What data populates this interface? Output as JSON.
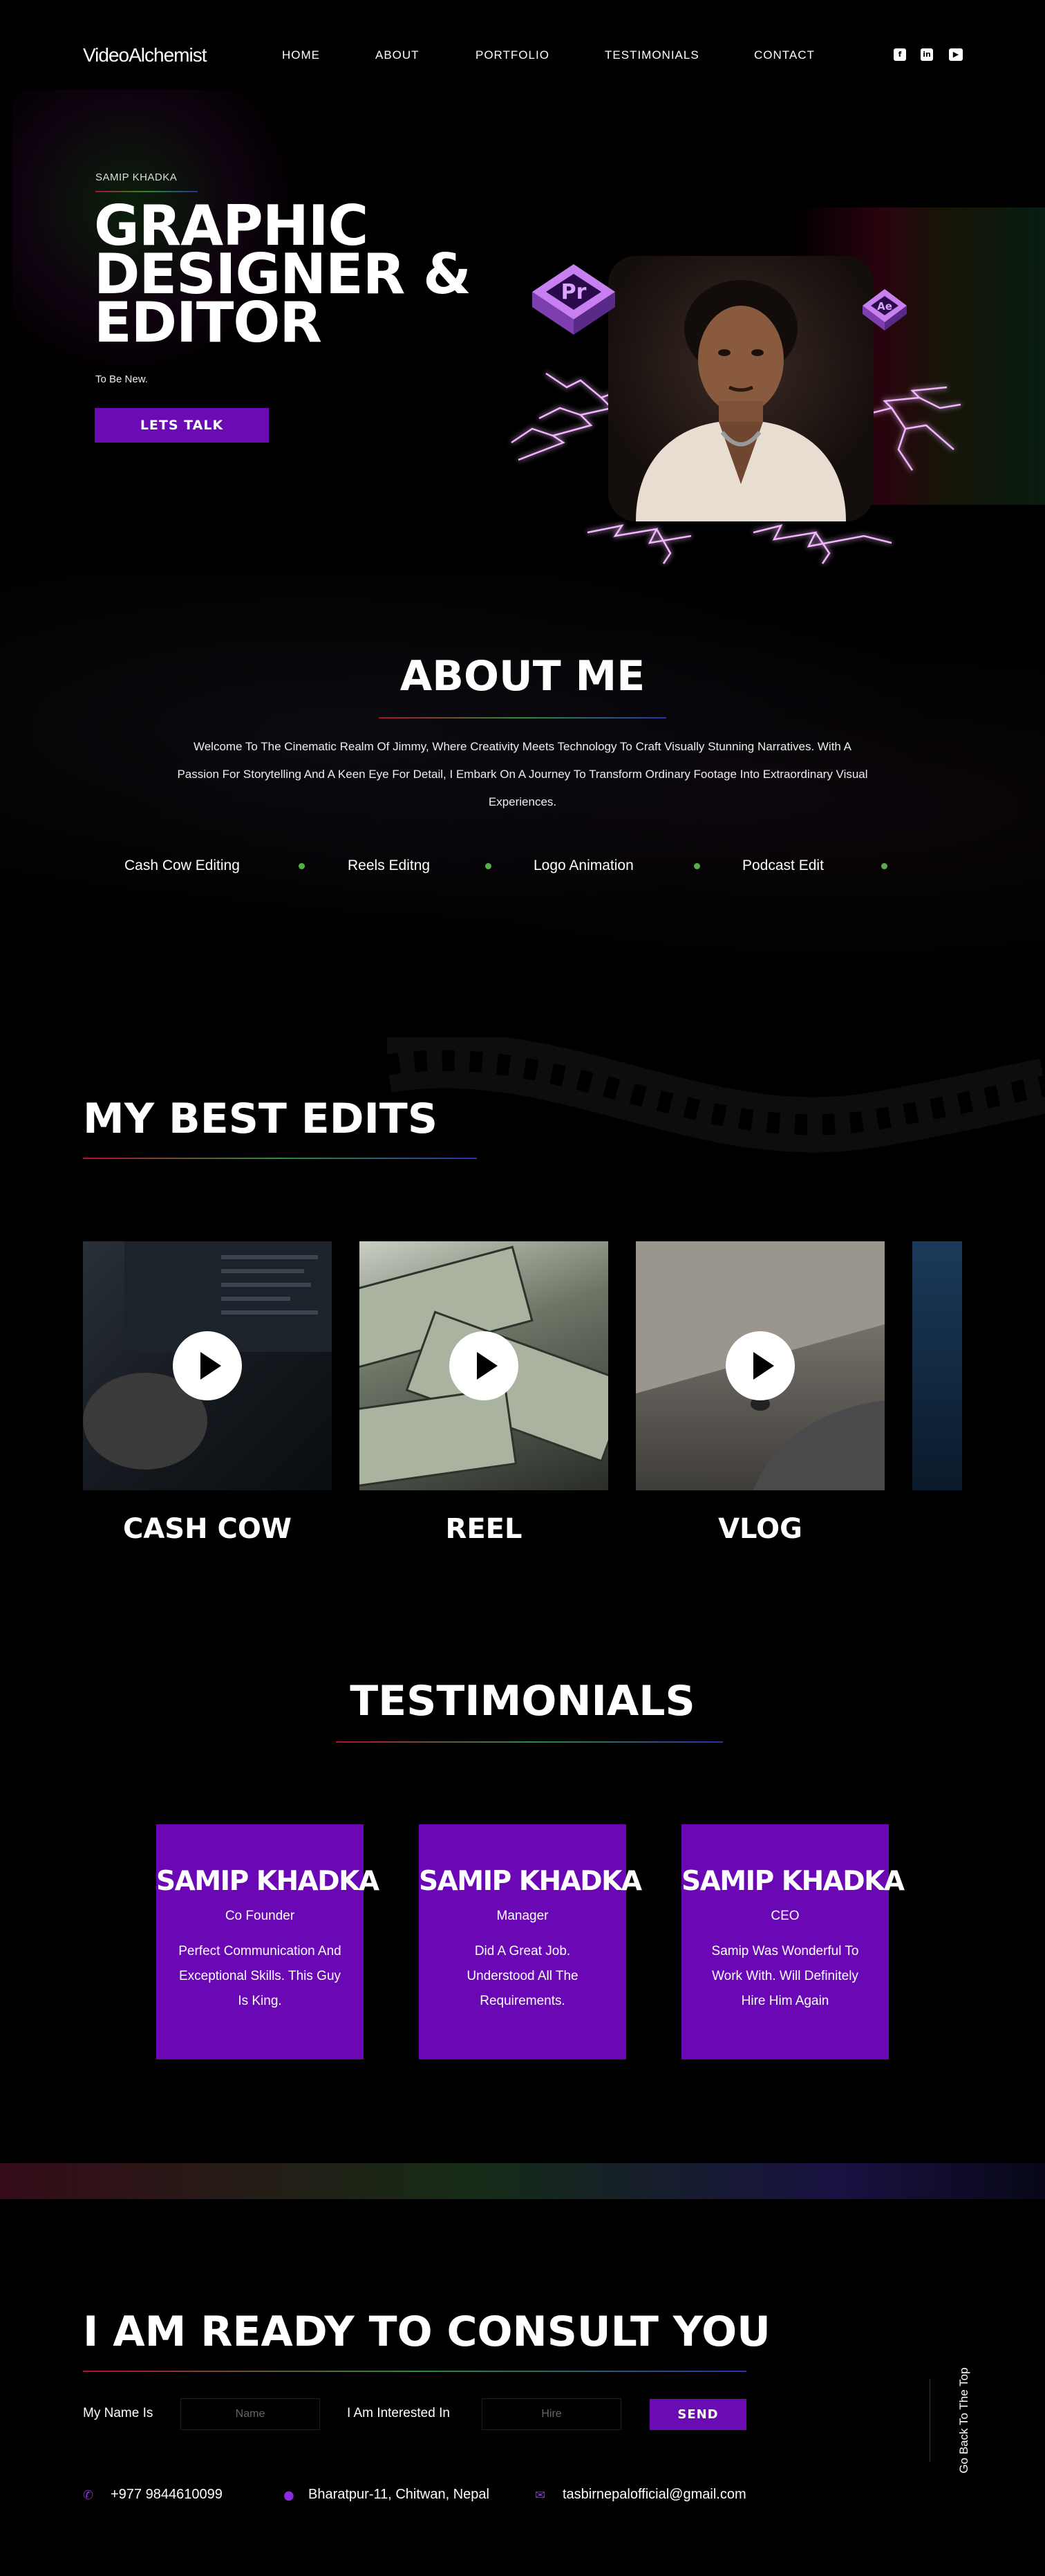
{
  "nav": {
    "logo": "VideoAlchemist",
    "links": [
      "HOME",
      "ABOUT",
      "PORTFOLIO",
      "TESTIMONIALS",
      "CONTACT"
    ],
    "social_icons": [
      "facebook-icon",
      "linkedin-icon",
      "youtube-icon"
    ]
  },
  "hero": {
    "name": "SAMIP KHADKA",
    "title_line1": "GRAPHIC",
    "title_line2": "DESIGNER &",
    "title_line3": "EDITOR",
    "tagline": "To Be New.",
    "cta": "LETS TALK",
    "app_icons": [
      "premiere-pro-icon",
      "after-effects-icon"
    ]
  },
  "about": {
    "title": "ABOUT ME",
    "paragraph": "Welcome To The Cinematic Realm Of Jimmy, Where Creativity Meets Technology To Craft Visually Stunning Narratives. With A Passion For Storytelling And A Keen Eye For Detail, I Embark On A Journey To Transform Ordinary Footage Into Extraordinary Visual Experiences.",
    "skills": [
      "Cash Cow Editing",
      "Reels Editng",
      "Logo Animation",
      "Podcast Edit"
    ]
  },
  "edits": {
    "title": "MY BEST EDITS",
    "items": [
      {
        "label": "CASH COW"
      },
      {
        "label": "REEL"
      },
      {
        "label": "VLOG"
      }
    ]
  },
  "testimonials": {
    "title": "TESTIMONIALS",
    "items": [
      {
        "name": "SAMIP KHADKA",
        "role": "Co Founder",
        "quote": "Perfect Communication And Exceptional Skills. This Guy Is King."
      },
      {
        "name": "SAMIP KHADKA",
        "role": "Manager",
        "quote": "Did A Great Job. Understood All The Requirements."
      },
      {
        "name": "SAMIP KHADKA",
        "role": "CEO",
        "quote": "Samip Was Wonderful To Work With. Will Definitely Hire Him Again"
      }
    ]
  },
  "contact": {
    "title": "I AM READY TO CONSULT YOU",
    "name_label": "My Name Is",
    "name_placeholder": "Name",
    "interest_label": "I Am Interested In",
    "interest_placeholder": "Hire",
    "send": "SEND",
    "phone": "+977 9844610099",
    "address": "Bharatpur-11, Chitwan, Nepal",
    "email": "tasbirnepalofficial@gmail.com",
    "back_to_top": "Go Back To The Top"
  },
  "colors": {
    "accent": "#6a0bb3",
    "card": "#6b08b5",
    "background": "#000000"
  }
}
